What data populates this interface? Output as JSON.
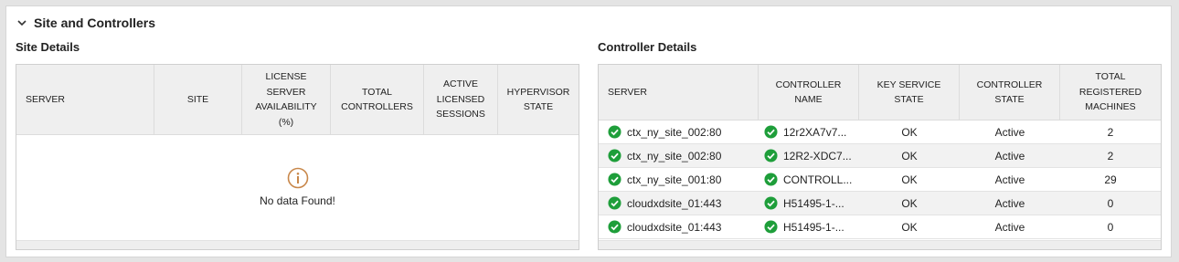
{
  "panel": {
    "title": "Site and Controllers"
  },
  "site": {
    "title": "Site Details",
    "columns": [
      [
        "SERVER"
      ],
      [
        "SITE"
      ],
      [
        "LICENSE",
        "SERVER",
        "AVAILABILITY",
        "(%)"
      ],
      [
        "TOTAL",
        "CONTROLLERS"
      ],
      [
        "ACTIVE",
        "LICENSED",
        "SESSIONS"
      ],
      [
        "HYPERVISOR",
        "STATE"
      ]
    ],
    "empty_text": "No data Found!"
  },
  "controller": {
    "title": "Controller Details",
    "columns": [
      [
        "SERVER"
      ],
      [
        "CONTROLLER",
        "NAME"
      ],
      [
        "KEY SERVICE",
        "STATE"
      ],
      [
        "CONTROLLER",
        "STATE"
      ],
      [
        "TOTAL",
        "REGISTERED",
        "MACHINES"
      ]
    ],
    "rows": [
      {
        "server": "ctx_ny_site_002:80",
        "name": "12r2XA7v7...",
        "key_state": "OK",
        "state": "Active",
        "machines": "2"
      },
      {
        "server": "ctx_ny_site_002:80",
        "name": "12R2-XDC7...",
        "key_state": "OK",
        "state": "Active",
        "machines": "2"
      },
      {
        "server": "ctx_ny_site_001:80",
        "name": "CONTROLL...",
        "key_state": "OK",
        "state": "Active",
        "machines": "29"
      },
      {
        "server": "cloudxdsite_01:443",
        "name": "H51495-1-...",
        "key_state": "OK",
        "state": "Active",
        "machines": "0"
      },
      {
        "server": "cloudxdsite_01:443",
        "name": "H51495-1-...",
        "key_state": "OK",
        "state": "Active",
        "machines": "0"
      }
    ]
  },
  "colors": {
    "ok_green": "#1e9e3a",
    "info_orange": "#c8874a"
  },
  "icons": {
    "collapse": "chevron-down-icon",
    "empty": "info-icon",
    "status": "check-circle-icon"
  }
}
